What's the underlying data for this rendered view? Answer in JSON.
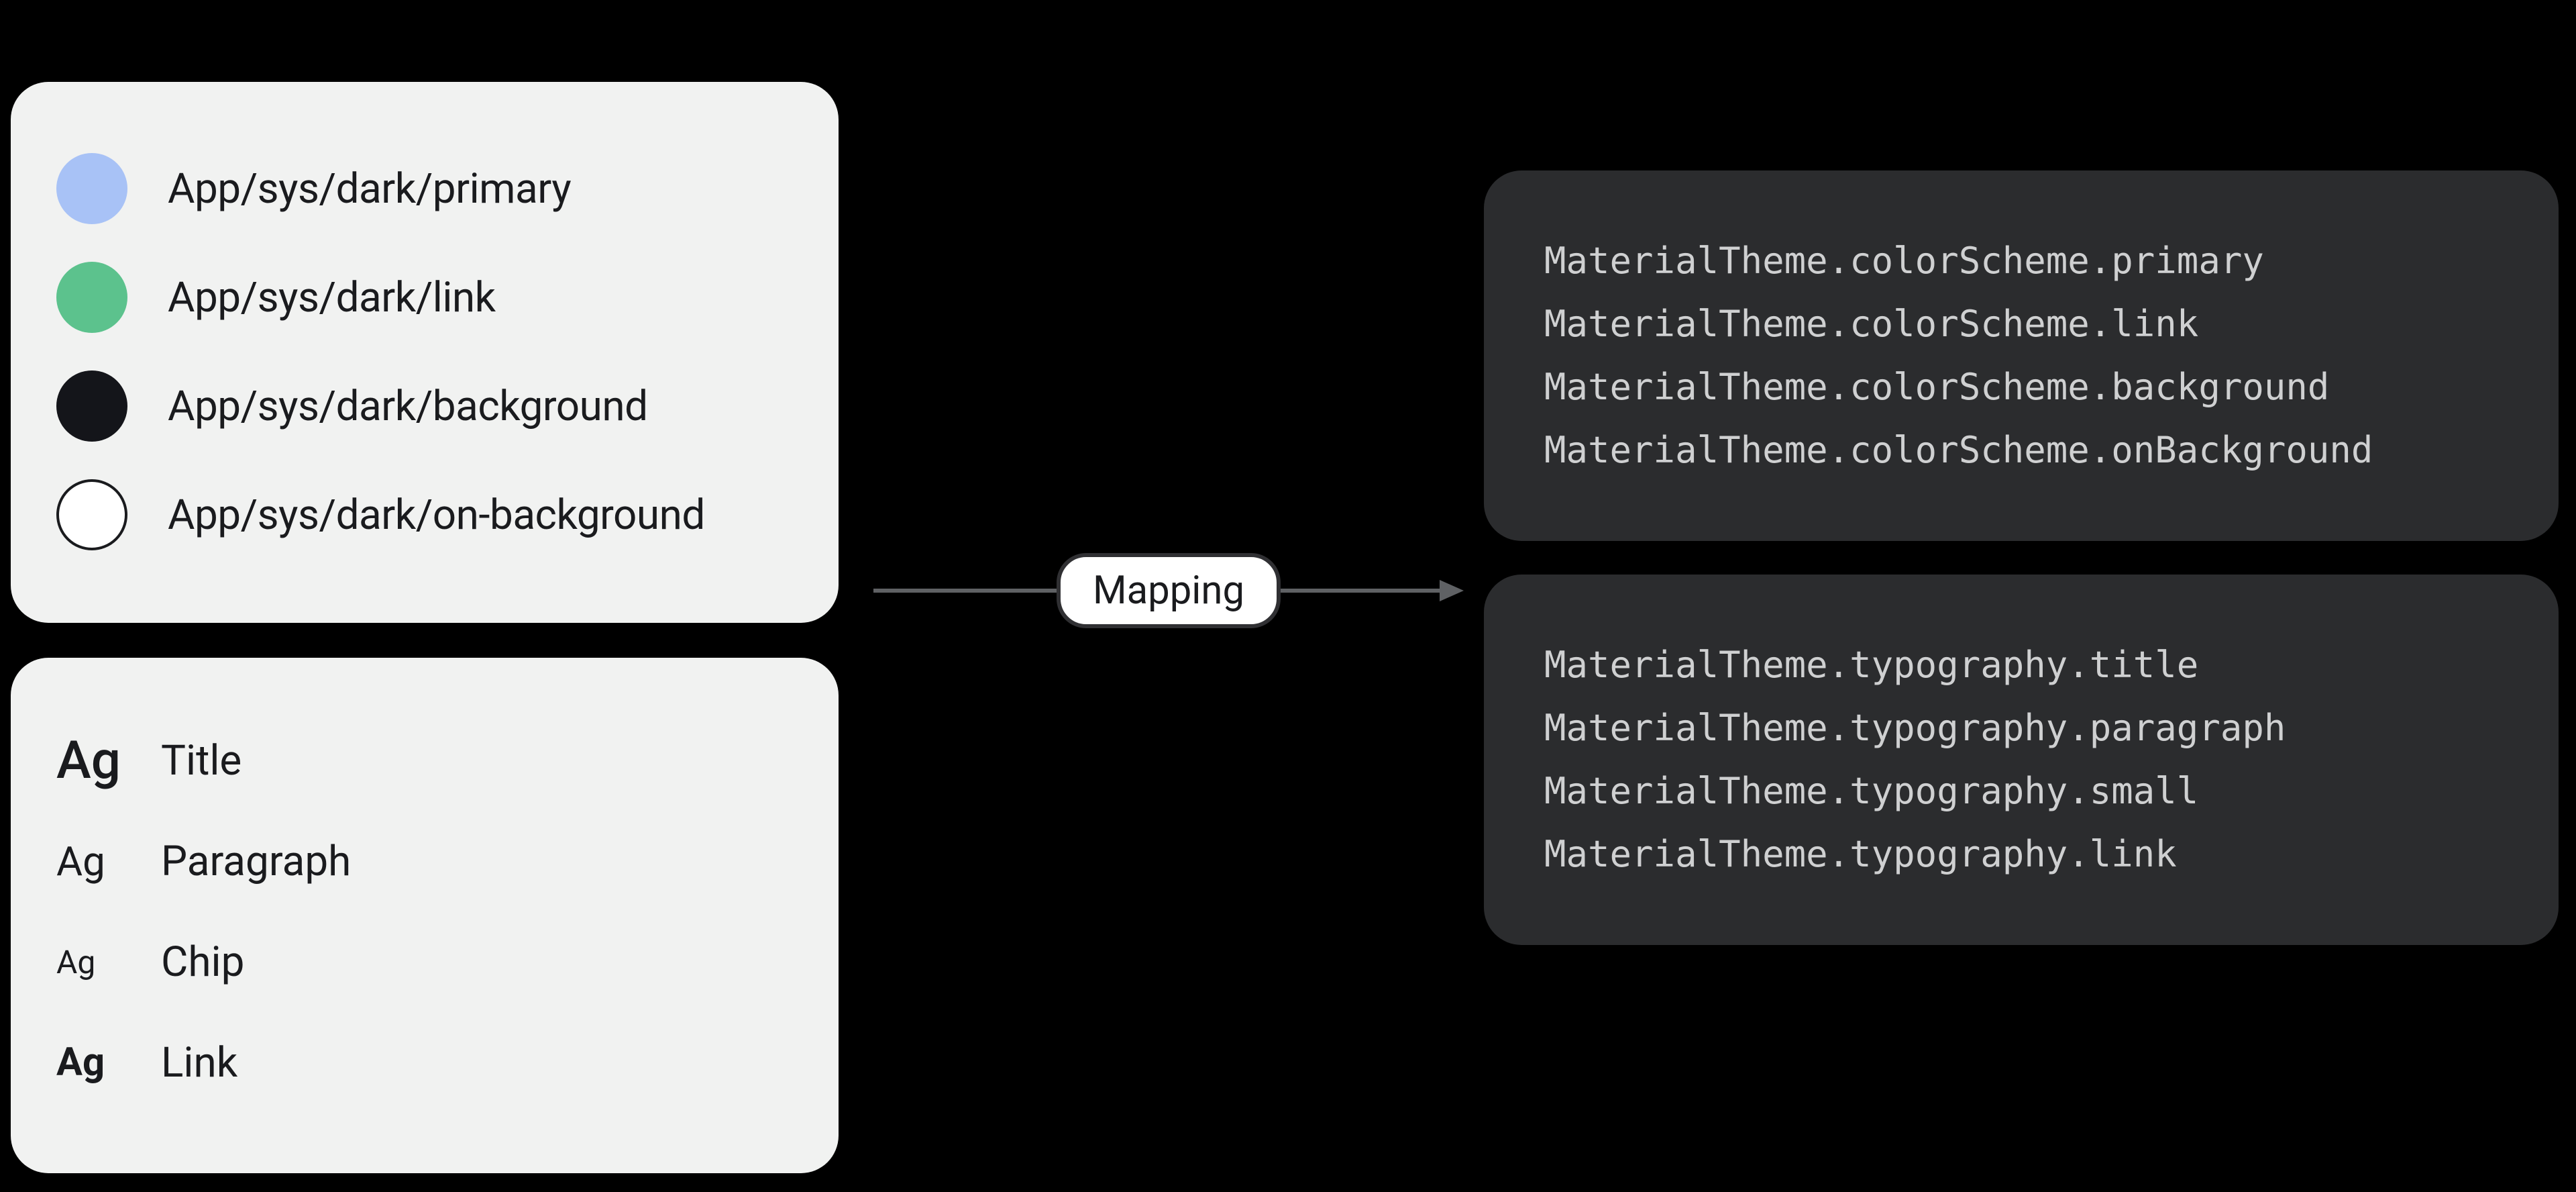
{
  "colors": {
    "swatches": {
      "primary": "#a8c2f6",
      "link": "#5cc28d",
      "background": "#14151a",
      "onBackground": "#ffffff"
    },
    "items": [
      {
        "key": "primary",
        "label": "App/sys/dark/primary"
      },
      {
        "key": "link",
        "label": "App/sys/dark/link"
      },
      {
        "key": "background",
        "label": "App/sys/dark/background"
      },
      {
        "key": "onBackground",
        "label": "App/sys/dark/on-background"
      }
    ]
  },
  "typography": {
    "sample": "Ag",
    "items": [
      {
        "key": "title",
        "label": "Title",
        "styleClass": "ts-title"
      },
      {
        "key": "paragraph",
        "label": "Paragraph",
        "styleClass": "ts-para"
      },
      {
        "key": "chip",
        "label": "Chip",
        "styleClass": "ts-chip"
      },
      {
        "key": "link",
        "label": "Link",
        "styleClass": "ts-link"
      }
    ]
  },
  "mapping": {
    "label": "Mapping"
  },
  "code": {
    "colorScheme": [
      "MaterialTheme.colorScheme.primary",
      "MaterialTheme.colorScheme.link",
      "MaterialTheme.colorScheme.background",
      "MaterialTheme.colorScheme.onBackground"
    ],
    "typography": [
      "MaterialTheme.typography.title",
      "MaterialTheme.typography.paragraph",
      "MaterialTheme.typography.small",
      "MaterialTheme.typography.link"
    ]
  }
}
